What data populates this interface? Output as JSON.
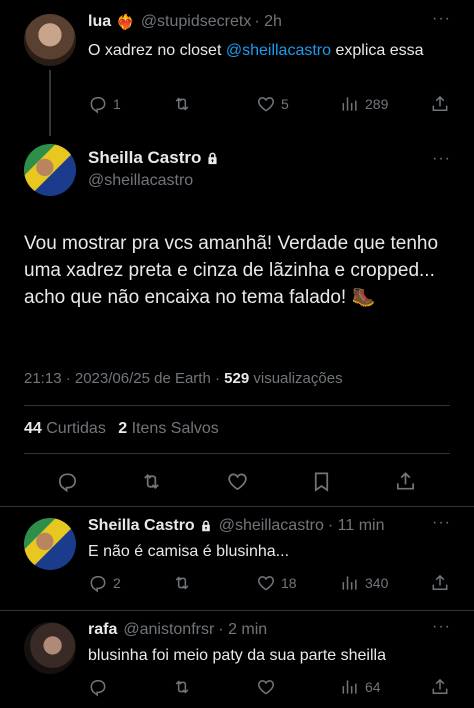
{
  "reply_top": {
    "name": "lua",
    "emoji": "❤‍🔥",
    "handle": "@stupidsecretx",
    "time": "· 2h",
    "text_prefix": "O xadrez no closet ",
    "mention": "@sheillacastro",
    "text_suffix": " explica essa",
    "reply_count": "1",
    "retweet_count": "",
    "like_count": "5",
    "view_count": "289"
  },
  "main_tweet": {
    "name": "Sheilla Castro",
    "handle": "@sheillacastro",
    "text": "Vou mostrar pra vcs amanhã! Verdade que tenho uma xadrez preta e cinza de lãzinha e cropped... acho que não encaixa no tema falado! 🥾",
    "timestamp": "21:13 · 2023/06/25 de Earth ·",
    "views_count": "529",
    "views_label": "visualizações",
    "likes_count": "44",
    "likes_label": "Curtidas",
    "saves_count": "2",
    "saves_label": "Itens Salvos"
  },
  "reply_sheilla": {
    "name": "Sheilla Castro",
    "handle": "@sheillacastro",
    "time": "· 11 min",
    "text": "E não é camisa é blusinha...",
    "reply_count": "2",
    "like_count": "18",
    "view_count": "340"
  },
  "reply_rafa": {
    "name": "rafa",
    "handle": "@anistonfrsr",
    "time": "· 2 min",
    "text": "blusinha foi meio paty da sua parte sheilla",
    "reply_count": "",
    "like_count": "",
    "view_count": "64"
  },
  "icons": {
    "reply": "reply-icon",
    "retweet": "retweet-icon",
    "like": "heart-icon",
    "views": "views-icon",
    "share": "share-icon",
    "bookmark": "bookmark-icon",
    "lock": "lock-icon",
    "more": "more-icon"
  },
  "colors": {
    "background": "#000000",
    "text": "#e7e9ea",
    "muted": "#71767b",
    "link": "#1d9bf0",
    "divider": "#2f3336"
  }
}
